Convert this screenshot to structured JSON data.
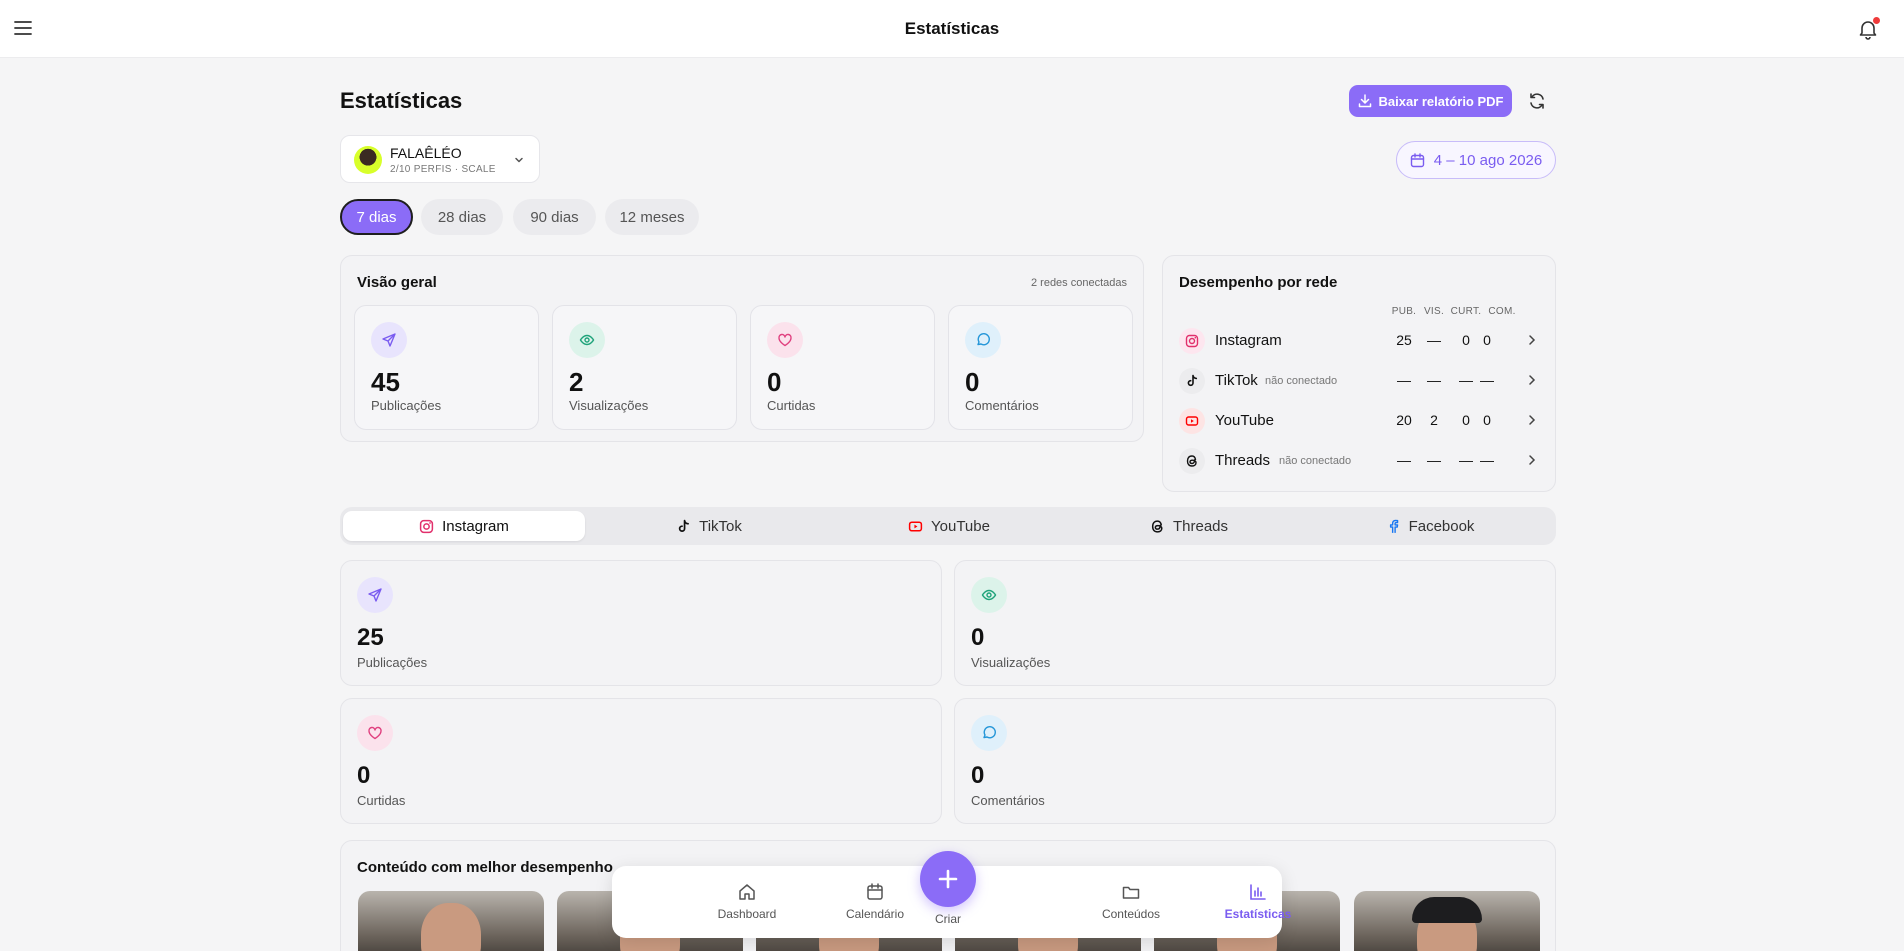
{
  "header": {
    "title": "Estatísticas"
  },
  "page": {
    "title": "Estatísticas",
    "pdf_label": "Baixar relatório PDF"
  },
  "profile": {
    "name": "FALAÊLÉO",
    "sub": "2/10 PERFIS · SCALE"
  },
  "date_range": "4 – 10 ago 2026",
  "periods": [
    "7 dias",
    "28 dias",
    "90 dias",
    "12 meses"
  ],
  "overview": {
    "title": "Visão geral",
    "meta": "2 redes conectadas",
    "metrics": [
      {
        "value": "45",
        "label": "Publicações",
        "icon": "send-icon"
      },
      {
        "value": "2",
        "label": "Visualizações",
        "icon": "eye-icon"
      },
      {
        "value": "0",
        "label": "Curtidas",
        "icon": "heart-icon"
      },
      {
        "value": "0",
        "label": "Comentários",
        "icon": "comment-icon"
      }
    ]
  },
  "network": {
    "title": "Desempenho por rede",
    "columns": [
      "PUB.",
      "VIS.",
      "CURT.",
      "COM."
    ],
    "rows": [
      {
        "name": "Instagram",
        "status": "",
        "values": [
          "25",
          "—",
          "0",
          "0"
        ]
      },
      {
        "name": "TikTok",
        "status": "não conectado",
        "values": [
          "—",
          "—",
          "—",
          "—"
        ]
      },
      {
        "name": "YouTube",
        "status": "",
        "values": [
          "20",
          "2",
          "0",
          "0"
        ]
      },
      {
        "name": "Threads",
        "status": "não conectado",
        "values": [
          "—",
          "—",
          "—",
          "—"
        ]
      }
    ]
  },
  "tabs": [
    "Instagram",
    "TikTok",
    "YouTube",
    "Threads",
    "Facebook"
  ],
  "detail": [
    {
      "value": "25",
      "label": "Publicações"
    },
    {
      "value": "0",
      "label": "Visualizações"
    },
    {
      "value": "0",
      "label": "Curtidas"
    },
    {
      "value": "0",
      "label": "Comentários"
    }
  ],
  "best": {
    "title": "Conteúdo com melhor desempenho"
  },
  "nav": {
    "dashboard": "Dashboard",
    "calendar": "Calendário",
    "create": "Criar",
    "contents": "Conteúdos",
    "stats": "Estatísticas"
  },
  "colors": {
    "accent": "#8b6cf7",
    "instagram": "#e1306c",
    "youtube": "#ff0000",
    "facebook": "#1877f2"
  }
}
